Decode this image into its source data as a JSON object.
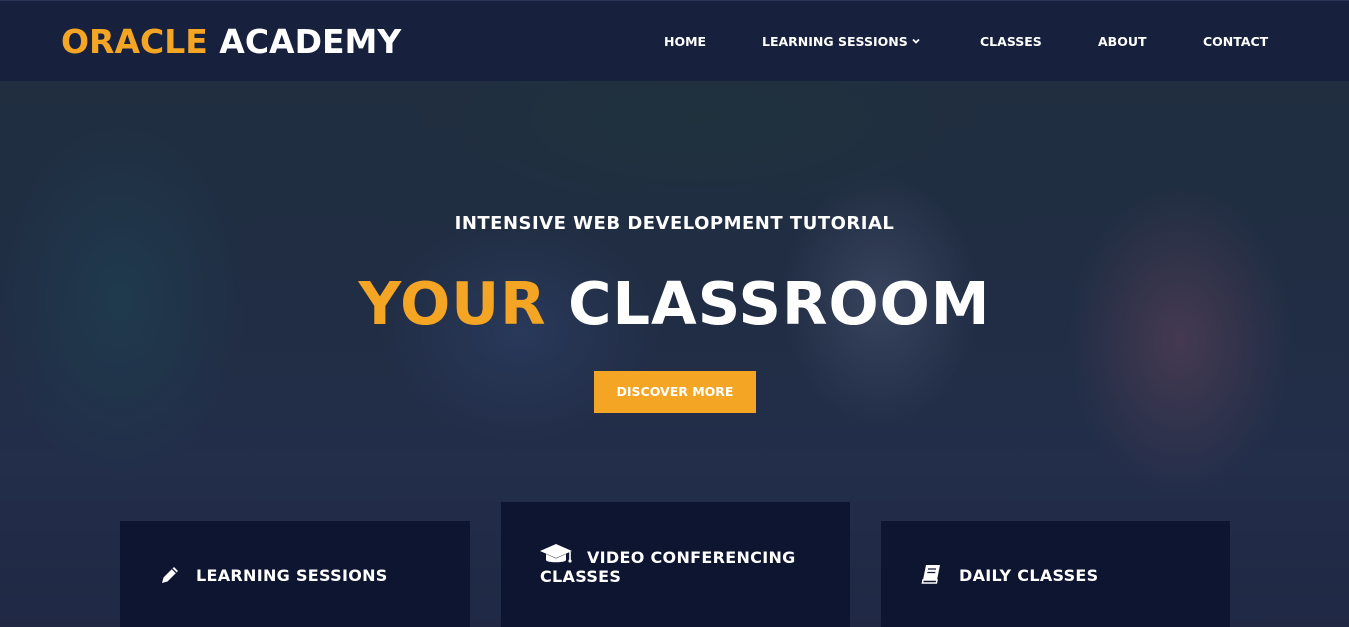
{
  "brand": {
    "logo_accent": "ORACLE",
    "logo_rest": "ACADEMY",
    "accent_color": "#f5a524"
  },
  "nav": {
    "items": [
      {
        "label": "HOME"
      },
      {
        "label": "LEARNING SESSIONS",
        "has_dropdown": true,
        "icon": "chevron-down-icon"
      },
      {
        "label": "CLASSES"
      },
      {
        "label": "ABOUT"
      },
      {
        "label": "CONTACT"
      }
    ]
  },
  "hero": {
    "subtitle": "INTENSIVE WEB DEVELOPMENT TUTORIAL",
    "headline_accent": "YOUR",
    "headline_rest": "CLASSROOM",
    "cta_label": "DISCOVER MORE"
  },
  "features": [
    {
      "icon": "pencil-icon",
      "label": "LEARNING SESSIONS"
    },
    {
      "icon": "graduation-cap-icon",
      "label_line1": "VIDEO CONFERENCING",
      "label_line2": "CLASSES"
    },
    {
      "icon": "book-icon",
      "label": "DAILY CLASSES"
    }
  ]
}
